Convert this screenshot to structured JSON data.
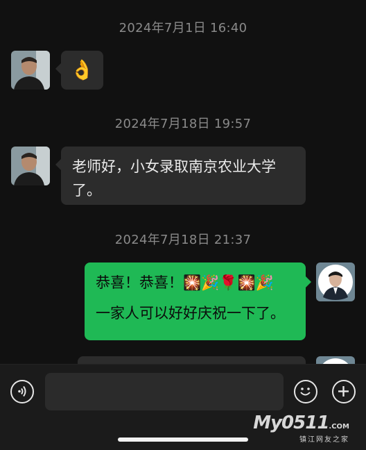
{
  "messages": [
    {
      "timestamp": "2024年7月1日 16:40",
      "sender": "other",
      "text": "👌"
    },
    {
      "timestamp": "2024年7月18日 19:57",
      "sender": "other",
      "lines": [
        "老师好，小女录取南京农业大学",
        "了。"
      ]
    },
    {
      "timestamp": "2024年7月18日 21:37",
      "sender": "self",
      "lines": [
        "恭喜！恭喜！🎇🎉🌹🎇🎉",
        "",
        "一家人可以好好庆祝一下了。"
      ]
    }
  ],
  "input_bar": {
    "voice_icon": "voice-icon",
    "emoji_icon": "emoji-icon",
    "add_icon": "plus-icon"
  },
  "watermark": {
    "main": "My0511",
    "domain": ".COM",
    "subtitle": "镇江网友之家"
  },
  "colors": {
    "background": "#111111",
    "bubble_other": "#2c2c2c",
    "bubble_self": "#1fb955"
  }
}
